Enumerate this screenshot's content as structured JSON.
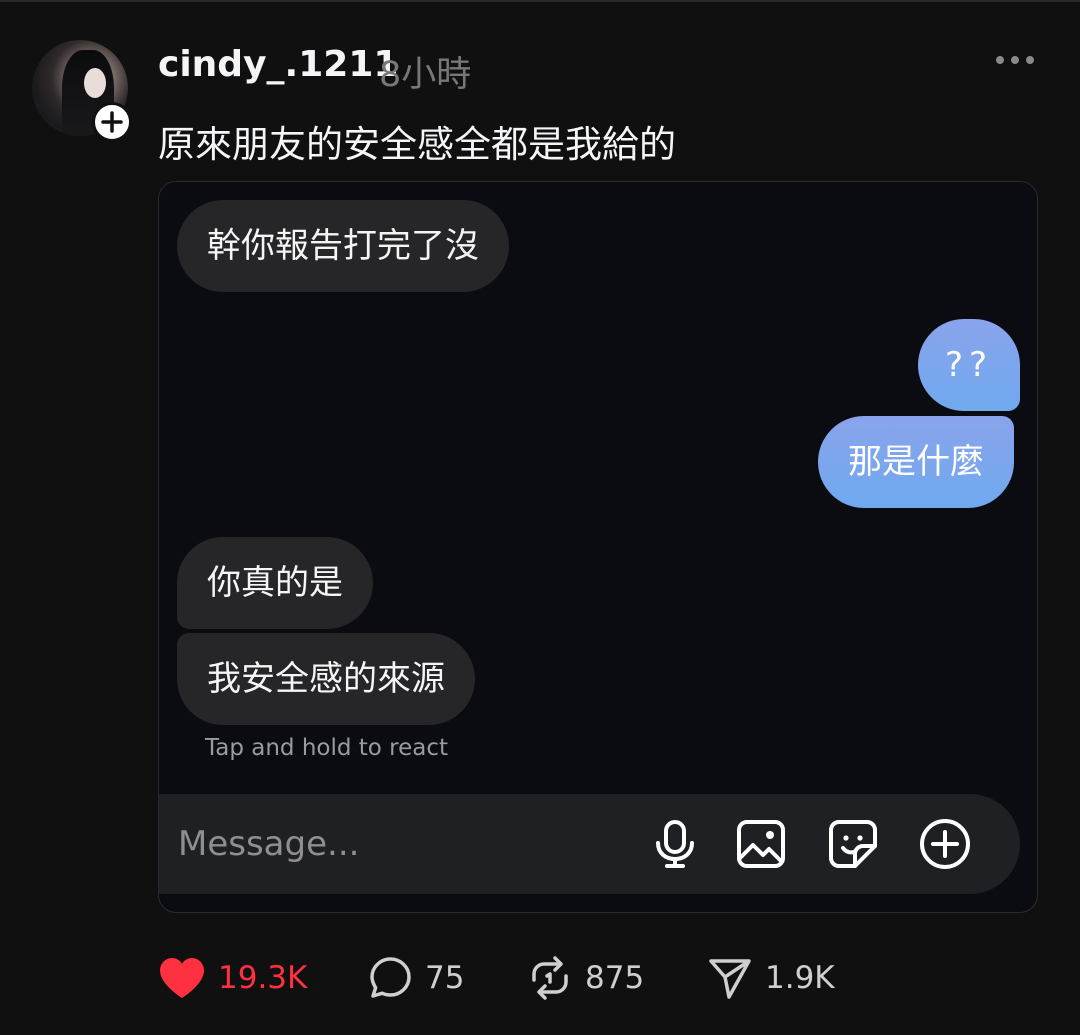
{
  "post": {
    "username": "cindy_.1211",
    "time": "8小時",
    "caption": "原來朋友的安全感全都是我給的"
  },
  "chat": {
    "messages": [
      {
        "side": "in",
        "text": "幹你報告打完了沒"
      },
      {
        "side": "out",
        "text": "??"
      },
      {
        "side": "out",
        "text": "那是什麼"
      },
      {
        "side": "in",
        "text": "你真的是"
      },
      {
        "side": "in",
        "text": "我安全感的來源"
      }
    ],
    "hint": "Tap and hold to react",
    "composer": {
      "placeholder": "Message...",
      "icons": [
        "microphone-icon",
        "image-icon",
        "sticker-icon",
        "add-icon"
      ]
    }
  },
  "actions": {
    "likes": "19.3K",
    "comments": "75",
    "reposts": "875",
    "shares": "1.9K"
  },
  "colors": {
    "background": "#101010",
    "like": "#ff3040",
    "outgoing_bubble": "#7ea6ee",
    "incoming_bubble": "#262629"
  }
}
